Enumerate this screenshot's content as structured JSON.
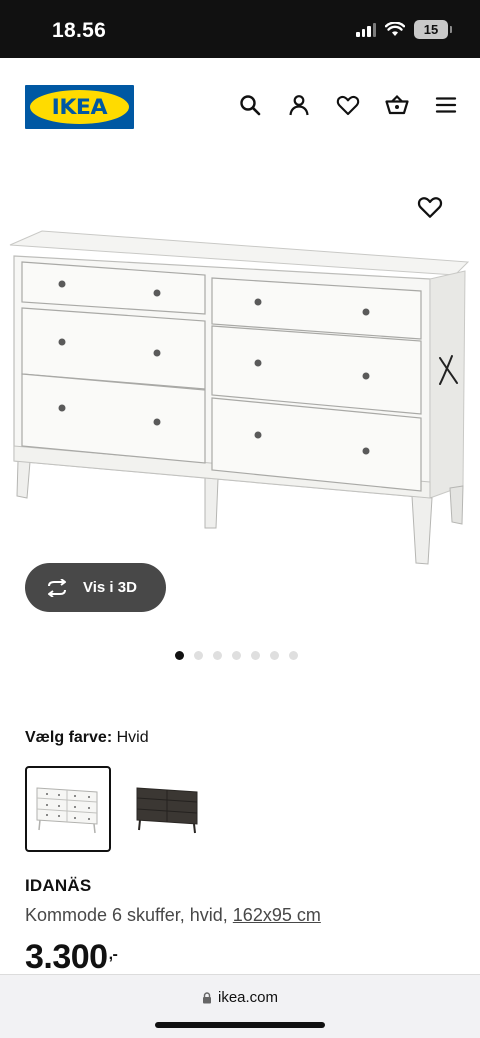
{
  "status_bar": {
    "time": "18.56",
    "battery": "15"
  },
  "header": {
    "logo_text": "IKEA",
    "icons": [
      "search-icon",
      "profile-icon",
      "heart-icon",
      "basket-icon",
      "menu-icon"
    ],
    "brand_colors": {
      "blue": "#0058a3",
      "yellow": "#ffdb00"
    }
  },
  "gallery": {
    "view_3d_label": "Vis i 3D",
    "slide_count": 7,
    "active_slide": 1
  },
  "color_picker": {
    "label": "Vælg farve:",
    "selected": "Hvid",
    "options": [
      "white",
      "dark-brown"
    ]
  },
  "product": {
    "name": "IDANÄS",
    "description": "Kommode 6 skuffer, hvid,",
    "dimensions": "162x95 cm",
    "price": "3.300",
    "price_suffix": ",-"
  },
  "browser": {
    "url": "ikea.com"
  }
}
